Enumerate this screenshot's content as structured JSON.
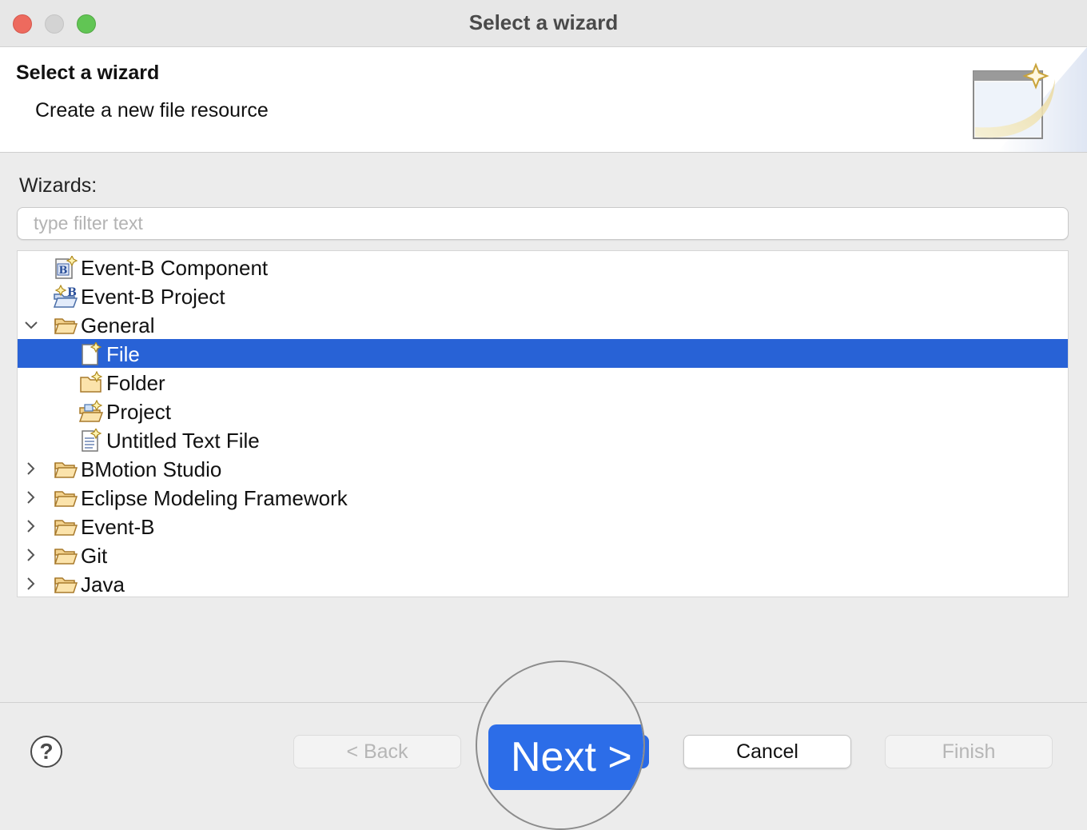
{
  "window": {
    "title": "Select a wizard"
  },
  "header": {
    "title": "Select a wizard",
    "description": "Create a new file resource"
  },
  "wizards": {
    "label": "Wizards:",
    "filter_placeholder": "type filter text",
    "filter_value": ""
  },
  "tree": {
    "items": [
      {
        "label": "Event-B Component",
        "icon": "event-b-component-icon",
        "level": 0,
        "expander": "none",
        "selected": false
      },
      {
        "label": "Event-B Project",
        "icon": "event-b-project-icon",
        "level": 0,
        "expander": "none",
        "selected": false
      },
      {
        "label": "General",
        "icon": "open-folder-icon",
        "level": 0,
        "expander": "expanded",
        "selected": false
      },
      {
        "label": "File",
        "icon": "new-file-icon",
        "level": 1,
        "expander": "none",
        "selected": true
      },
      {
        "label": "Folder",
        "icon": "new-folder-icon",
        "level": 1,
        "expander": "none",
        "selected": false
      },
      {
        "label": "Project",
        "icon": "new-project-icon",
        "level": 1,
        "expander": "none",
        "selected": false
      },
      {
        "label": "Untitled Text File",
        "icon": "text-file-icon",
        "level": 1,
        "expander": "none",
        "selected": false
      },
      {
        "label": "BMotion Studio",
        "icon": "open-folder-icon",
        "level": 0,
        "expander": "collapsed",
        "selected": false
      },
      {
        "label": "Eclipse Modeling Framework",
        "icon": "open-folder-icon",
        "level": 0,
        "expander": "collapsed",
        "selected": false
      },
      {
        "label": "Event-B",
        "icon": "open-folder-icon",
        "level": 0,
        "expander": "collapsed",
        "selected": false
      },
      {
        "label": "Git",
        "icon": "open-folder-icon",
        "level": 0,
        "expander": "collapsed",
        "selected": false
      },
      {
        "label": "Java",
        "icon": "open-folder-icon",
        "level": 0,
        "expander": "collapsed",
        "selected": false
      }
    ]
  },
  "buttons": {
    "help": "?",
    "back": "< Back",
    "next": "Next >",
    "cancel": "Cancel",
    "finish": "Finish"
  },
  "colors": {
    "selection": "#2862d6",
    "primary_button": "#2c6de8",
    "close": "#ed6a5e",
    "minimize": "#d3d3d3",
    "zoom": "#61c554"
  }
}
